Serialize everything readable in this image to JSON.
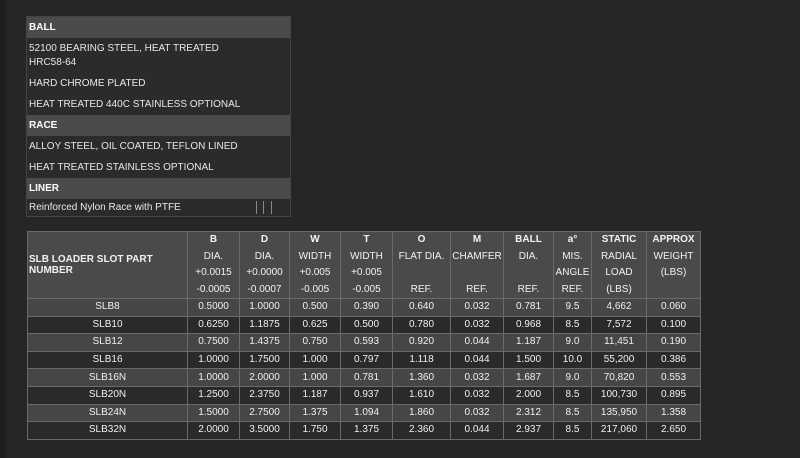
{
  "materials": {
    "ball": {
      "heading": "BALL",
      "lines": [
        "52100 BEARING STEEL, HEAT TREATED HRC58-64",
        "HARD CHROME PLATED",
        "HEAT TREATED 440C STAINLESS OPTIONAL"
      ]
    },
    "race": {
      "heading": "RACE",
      "lines": [
        "ALLOY STEEL, OIL COATED, TEFLON LINED",
        "HEAT TREATED STAINLESS OPTIONAL"
      ]
    },
    "liner": {
      "heading": "LINER",
      "lines": [
        "Reinforced Nylon Race with PTFE"
      ]
    }
  },
  "spec_table": {
    "part_header": "SLB LOADER SLOT PART NUMBER",
    "columns": [
      {
        "lines": [
          "B",
          "DIA.",
          "+0.0015",
          "-0.0005"
        ]
      },
      {
        "lines": [
          "D",
          "DIA.",
          "+0.0000",
          "-0.0007"
        ]
      },
      {
        "lines": [
          "W",
          "WIDTH",
          "+0.005",
          "-0.005"
        ]
      },
      {
        "lines": [
          "T",
          "WIDTH",
          "+0.005",
          "-0.005"
        ]
      },
      {
        "lines": [
          "O",
          "FLAT DIA.",
          "",
          "REF."
        ]
      },
      {
        "lines": [
          "M",
          "CHAMFER",
          "",
          "REF."
        ]
      },
      {
        "lines": [
          "BALL",
          "DIA.",
          "",
          "REF."
        ]
      },
      {
        "lines": [
          "a°",
          "MIS.",
          "ANGLE",
          "REF."
        ]
      },
      {
        "lines": [
          "STATIC",
          "RADIAL",
          "LOAD",
          "(LBS)"
        ]
      },
      {
        "lines": [
          "APPROX",
          "WEIGHT",
          "(LBS)",
          ""
        ]
      }
    ],
    "rows": [
      [
        "SLB8",
        "0.5000",
        "1.0000",
        "0.500",
        "0.390",
        "0.640",
        "0.032",
        "0.781",
        "9.5",
        "4,662",
        "0.060"
      ],
      [
        "SLB10",
        "0.6250",
        "1.1875",
        "0.625",
        "0.500",
        "0.780",
        "0.032",
        "0.968",
        "8.5",
        "7,572",
        "0.100"
      ],
      [
        "SLB12",
        "0.7500",
        "1.4375",
        "0.750",
        "0.593",
        "0.920",
        "0.044",
        "1.187",
        "9.0",
        "11,451",
        "0.190"
      ],
      [
        "SLB16",
        "1.0000",
        "1.7500",
        "1.000",
        "0.797",
        "1.118",
        "0.044",
        "1.500",
        "10.0",
        "55,200",
        "0.386"
      ],
      [
        "SLB16N",
        "1.0000",
        "2.0000",
        "1.000",
        "0.781",
        "1.360",
        "0.032",
        "1.687",
        "9.0",
        "70,820",
        "0.553"
      ],
      [
        "SLB20N",
        "1.2500",
        "2.3750",
        "1.187",
        "0.937",
        "1.610",
        "0.032",
        "2.000",
        "8.5",
        "100,730",
        "0.895"
      ],
      [
        "SLB24N",
        "1.5000",
        "2.7500",
        "1.375",
        "1.094",
        "1.860",
        "0.032",
        "2.312",
        "8.5",
        "135,950",
        "1.358"
      ],
      [
        "SLB32N",
        "2.0000",
        "3.5000",
        "1.750",
        "1.375",
        "2.360",
        "0.044",
        "2.937",
        "8.5",
        "217,060",
        "2.650"
      ]
    ]
  }
}
